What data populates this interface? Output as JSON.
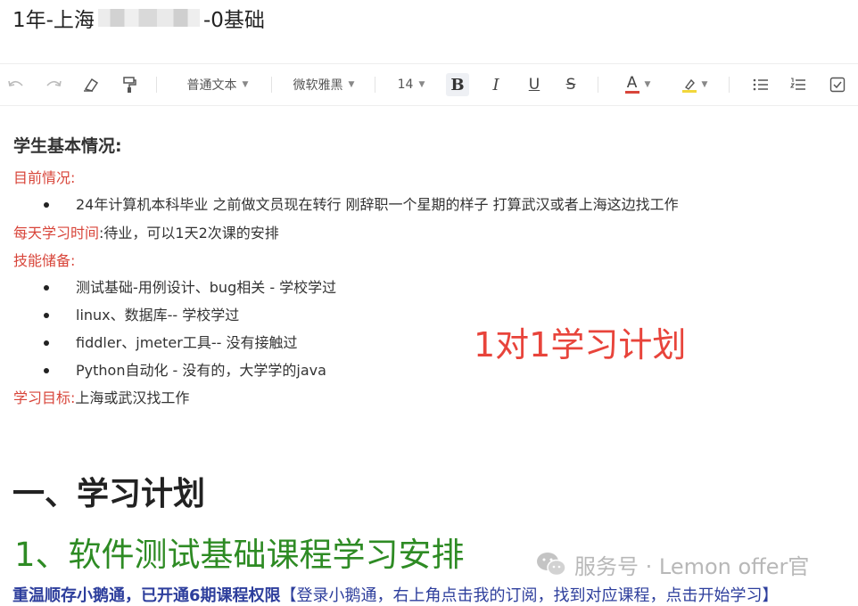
{
  "doc": {
    "title_prefix": "1年-上海",
    "title_suffix": "-0基础"
  },
  "toolbar": {
    "paragraph_style": "普通文本",
    "font_family": "微软雅黑",
    "font_size": "14",
    "bold": "B",
    "italic": "I",
    "underline": "U",
    "strikethrough": "S",
    "text_color": "A"
  },
  "content": {
    "basic_heading": "学生基本情况:",
    "current_label": "目前情况:",
    "current_items": [
      "24年计算机本科毕业 之前做文员现在转行 刚辞职一个星期的样子  打算武汉或者上海这边找工作"
    ],
    "daily_label": "每天学习时间",
    "daily_value": ":待业，可以1天2次课的安排",
    "skills_label": "技能储备:",
    "skills_items": [
      "测试基础-用例设计、bug相关 - 学校学过",
      "linux、数据库-- 学校学过",
      "fiddler、jmeter工具--  没有接触过",
      "Python自动化 - 没有的，大学学的java"
    ],
    "goal_label": "学习目标:",
    "goal_value": "上海或武汉找工作",
    "plan_note": "1对1学习计划",
    "section1_heading": "一、学习计划",
    "section1_sub": "1、软件测试基础课程学习安排",
    "bottom_bold": "重温顺存小鹅通，已开通6期课程权限",
    "bottom_text": "【登录小鹅通，右上角点击我的订阅，找到对应课程，点击开始学习】"
  },
  "watermark": {
    "text": "服务号 · Lemon offer官"
  },
  "colors": {
    "label_red": "#d8453a",
    "note_red": "#e8443b",
    "heading_green": "#2e8b24",
    "link_blue": "#2d3e9c"
  }
}
